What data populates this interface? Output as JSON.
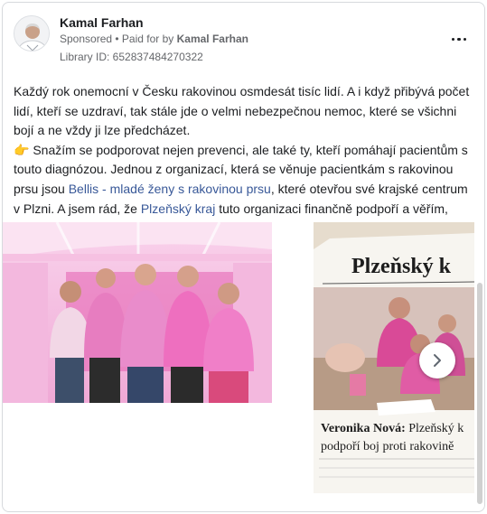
{
  "advertiser": {
    "name": "Kamal Farhan",
    "sponsored": "Sponsored",
    "paid_for_prefix": " • Paid for by ",
    "paid_for_name": "Kamal Farhan",
    "library_id": "Library ID: 652837484270322"
  },
  "post": {
    "para1": "Každý rok onemocní v Česku rakovinou osmdesát tisíc lidí. A i když přibývá počet lidí, kteří se uzdraví, tak stále jde o velmi nebezpečnou nemoc, které se všichni bojí a ne vždy ji lze předcházet.",
    "emoji": "👉",
    "para2_a": " Snažím se podporovat nejen prevenci, ale také ty, kteří pomáhají pacientům s touto diagnózou. Jednou z organizací, která se věnuje pacientkám s rakovinou prsu jsou ",
    "link1": "Bellis - mladé ženy s rakovinou prsu",
    "para2_b": ", které otevřou své krajské centrum v Plzni. A jsem rád, že ",
    "link2": "Plzeňský kraj",
    "para2_c": " tuto organizaci finančně podpoří a věřím, že..."
  },
  "carousel": {
    "newspaper_masthead": "Plzeňský k",
    "headline_name": "Veronika Nová:",
    "headline_rest": " Plzeňský k",
    "headline_line2": "podpoří boj proti rakovině"
  },
  "colors": {
    "link": "#385898",
    "muted": "#65676b",
    "pink": "#e889c4"
  },
  "icons": {
    "more": "more-horizontal-icon",
    "next": "chevron-right-icon"
  }
}
